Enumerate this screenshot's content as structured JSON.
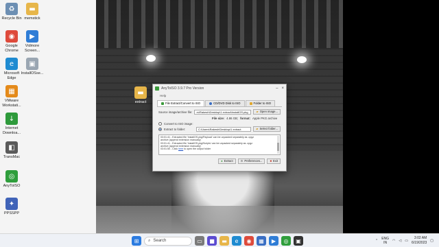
{
  "desktop": {
    "icons": [
      {
        "label": "Recycle Bin",
        "color": "#6d8fb3",
        "glyph": "♻"
      },
      {
        "label": "memstick",
        "color": "#e7b64a",
        "glyph": "▬"
      },
      {
        "label": "Google Chrome",
        "color": "#de4a3b",
        "glyph": "◉"
      },
      {
        "label": "Vidmore Screen...",
        "color": "#2f7dd6",
        "glyph": "▶"
      },
      {
        "label": "Microsoft Edge",
        "color": "#1f8bd1",
        "glyph": "e"
      },
      {
        "label": "InstallOSse...",
        "color": "#9aa6b2",
        "glyph": "▣"
      },
      {
        "label": "VMware Workstati...",
        "color": "#e48a1a",
        "glyph": "▦"
      },
      {
        "label": "Internet Downloa...",
        "color": "#2e9a3b",
        "glyph": "↓"
      },
      {
        "label": "TransMac",
        "color": "#5a5a5a",
        "glyph": "◧"
      },
      {
        "label": "AnyToISO",
        "color": "#2f9e3c",
        "glyph": "◎"
      },
      {
        "label": "PPSSPP",
        "color": "#4063b8",
        "glyph": "✦"
      },
      {
        "label": "extract",
        "color": "#e7b64a",
        "glyph": "▬"
      }
    ]
  },
  "dialog": {
    "title": "AnyToISO 3.9.7 Pro Version",
    "menu": "Help",
    "tabs": [
      {
        "label": "File Extract/Convert to ISO",
        "color": "#3c9a3c"
      },
      {
        "label": "CD/DVD Disk to ISO",
        "color": "#3a6fc4"
      },
      {
        "label": "Folder to ISO",
        "color": "#e0a82e"
      }
    ],
    "source_label": "Source image/archive file:",
    "source_value": "rs\\Rakesh\\Desktop\\1 extract\\InstallOS.pkg",
    "open_button": "Open image...",
    "file_size_label": "File size:",
    "file_size_value": "4.86 GB;",
    "format_label": "format:",
    "format_value": "Apple PKG archive",
    "convert_option": "Convert to ISO image:",
    "extract_option": "Extract to folder:",
    "extract_path": "C:\\Users\\Rakesh\\Desktop\\1 extract",
    "select_button": "Select folder...",
    "log": [
      "03:01:41 - Extracted file 'InstallOS.pkg/Payload' can be unpacked separately as .cpgz",
      "archive (append extension manually)",
      "03:01:41 - Extracted file 'InstallOS.pkg/Scripts' can be unpacked separately as .cpgz",
      "archive (append extension manually)"
    ],
    "log_last_prefix": "03:01:50 - Click ",
    "log_link": "here",
    "log_last_suffix": " to open the output folder",
    "extract_button": "Extract",
    "preferences_button": "Preferences...",
    "exit_button": "Exit"
  },
  "taskbar": {
    "search_placeholder": "Search",
    "lang_top": "ENG",
    "lang_bottom": "IN",
    "time": "3:02 AM",
    "date": "6/19/2023"
  }
}
